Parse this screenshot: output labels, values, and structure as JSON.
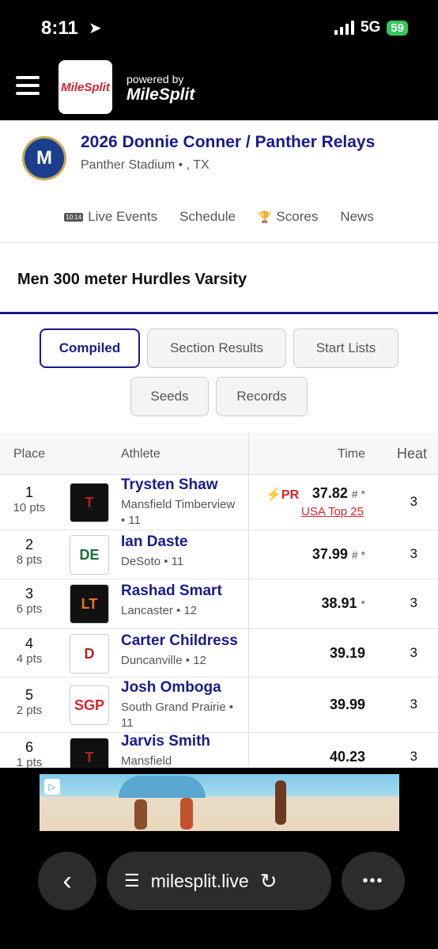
{
  "status_bar": {
    "time": "8:11",
    "network": "5G",
    "battery": "59"
  },
  "header": {
    "logo_text": "MileSplit",
    "powered_by": "powered by",
    "powered_brand": "MileSplit"
  },
  "meet": {
    "seal_letter": "M",
    "title": "2026 Donnie Conner / Panther Relays",
    "venue": "Panther Stadium • , TX"
  },
  "nav": {
    "live_icon_text": "10:14",
    "live": "Live Events",
    "schedule": "Schedule",
    "scores": "Scores",
    "news": "News"
  },
  "event": {
    "title": "Men 300 meter Hurdles Varsity"
  },
  "tabs": {
    "compiled": "Compiled",
    "section_results": "Section Results",
    "start_lists": "Start Lists",
    "seeds": "Seeds",
    "records": "Records"
  },
  "table": {
    "headers": {
      "place": "Place",
      "athlete": "Athlete",
      "time": "Time",
      "heat": "Heat"
    },
    "rows": [
      {
        "place": "1",
        "pts": "10 pts",
        "logo": "T",
        "name": "Trysten Shaw",
        "school": "Mansfield Timberview • 11",
        "time": "37.82",
        "marks": "# *",
        "pr": "PR",
        "note": "USA Top 25",
        "heat": "3"
      },
      {
        "place": "2",
        "pts": "8 pts",
        "logo": "DE",
        "name": "Ian Daste",
        "school": "DeSoto • 11",
        "time": "37.99",
        "marks": "# *",
        "heat": "3"
      },
      {
        "place": "3",
        "pts": "6 pts",
        "logo": "LT",
        "name": "Rashad Smart",
        "school": "Lancaster • 12",
        "time": "38.91",
        "marks": "*",
        "heat": "3"
      },
      {
        "place": "4",
        "pts": "4 pts",
        "logo": "D",
        "name": "Carter Childress",
        "school": "Duncanville • 12",
        "time": "39.19",
        "marks": "",
        "heat": "3"
      },
      {
        "place": "5",
        "pts": "2 pts",
        "logo": "SGP",
        "name": "Josh Omboga",
        "school": "South Grand Prairie • 11",
        "time": "39.99",
        "marks": "",
        "heat": "3"
      },
      {
        "place": "6",
        "pts": "1 pts",
        "logo": "T",
        "name": "Jarvis Smith",
        "school": "Mansfield",
        "time": "40.23",
        "marks": "",
        "heat": "3"
      }
    ]
  },
  "browser": {
    "url": "milesplit.live",
    "back_icon": "‹",
    "more_icon": "•••",
    "reload_icon": "↻"
  },
  "colors": {
    "brand_navy": "#1a1a8c",
    "brand_red": "#d9232e",
    "battery_green": "#34c759"
  }
}
